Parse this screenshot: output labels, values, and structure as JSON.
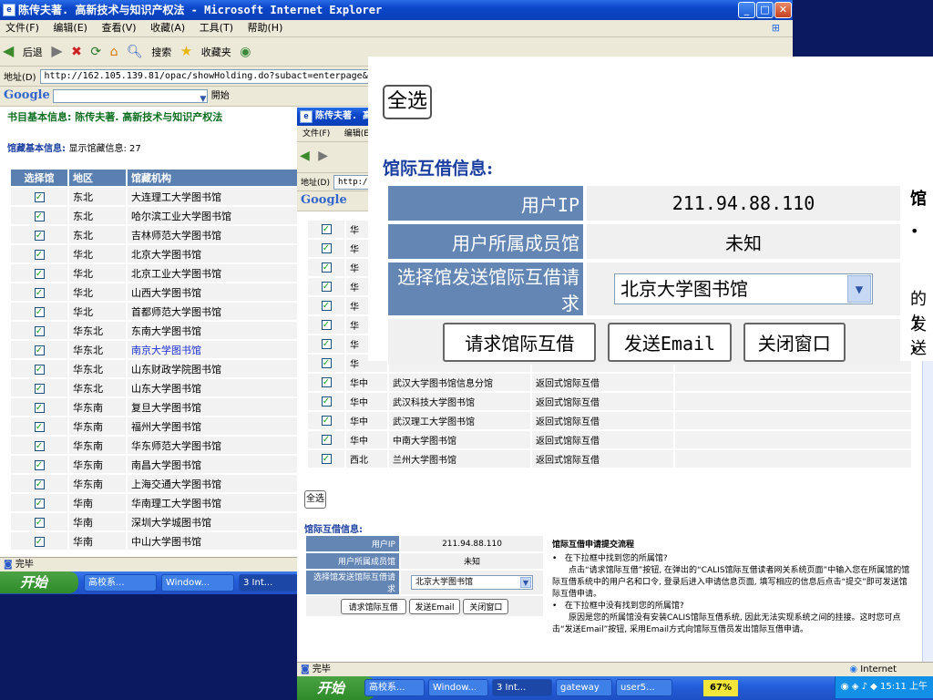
{
  "back_window": {
    "title": "陈传夫著. 高新技术与知识产权法 - Microsoft Internet Explorer",
    "menu": [
      "文件(F)",
      "编辑(E)",
      "查看(V)",
      "收藏(A)",
      "工具(T)",
      "帮助(H)"
    ],
    "toolbar": {
      "back": "后退",
      "search": "搜索",
      "favorites": "收藏夹"
    },
    "address_label": "地址(D)",
    "address": "http://162.105.139.81/opac/showHolding.do?subact=enterpage&fromType",
    "google_label": "Google",
    "google_button": "開始",
    "book_info": "书目基本信息: 陈传夫著. 高新技术与知识产权法",
    "holding_label": "馆藏基本信息:",
    "holding_count": "显示馆藏信息: 27",
    "table_headers": [
      "选择馆",
      "地区",
      "馆藏机构"
    ],
    "rows": [
      {
        "region": "东北",
        "lib": "大连理工大学图书馆"
      },
      {
        "region": "东北",
        "lib": "哈尔滨工业大学图书馆"
      },
      {
        "region": "东北",
        "lib": "吉林师范大学图书馆"
      },
      {
        "region": "华北",
        "lib": "北京大学图书馆"
      },
      {
        "region": "华北",
        "lib": "北京工业大学图书馆"
      },
      {
        "region": "华北",
        "lib": "山西大学图书馆"
      },
      {
        "region": "华北",
        "lib": "首都师范大学图书馆"
      },
      {
        "region": "华东北",
        "lib": "东南大学图书馆"
      },
      {
        "region": "华东北",
        "lib": "南京大学图书馆"
      },
      {
        "region": "华东北",
        "lib": "山东财政学院图书馆"
      },
      {
        "region": "华东北",
        "lib": "山东大学图书馆"
      },
      {
        "region": "华东南",
        "lib": "复旦大学图书馆"
      },
      {
        "region": "华东南",
        "lib": "福州大学图书馆"
      },
      {
        "region": "华东南",
        "lib": "华东师范大学图书馆"
      },
      {
        "region": "华东南",
        "lib": "南昌大学图书馆"
      },
      {
        "region": "华东南",
        "lib": "上海交通大学图书馆"
      },
      {
        "region": "华南",
        "lib": "华南理工大学图书馆"
      },
      {
        "region": "华南",
        "lib": "深圳大学城图书馆"
      },
      {
        "region": "华南",
        "lib": "中山大学图书馆"
      }
    ],
    "highlight_index": 8,
    "status": "完毕",
    "colors": {
      "header_green": "#0e6f20",
      "link_blue": "#1b3fa0",
      "table_head": "#5a7fb1",
      "highlight": "#1a2fd0"
    }
  },
  "back_taskbar": {
    "start": "开始",
    "tasks": [
      "高校系...",
      "Window...",
      "3 Int..."
    ]
  },
  "front_window": {
    "title": "陈传夫著. 高新",
    "menu": [
      "文件(F)",
      "编辑(E)"
    ],
    "address_label": "地址(D)",
    "address_short": "http://",
    "google_label": "Google",
    "rows": [
      {
        "region": "华中",
        "lib": "武汉大学图书馆信息分馆",
        "type": "返回式馆际互借"
      },
      {
        "region": "华中",
        "lib": "武汉科技大学图书馆",
        "type": "返回式馆际互借"
      },
      {
        "region": "华中",
        "lib": "武汉理工大学图书馆",
        "type": "返回式馆际互借"
      },
      {
        "region": "华中",
        "lib": "中南大学图书馆",
        "type": "返回式馆际互借"
      },
      {
        "region": "西北",
        "lib": "兰州大学图书馆",
        "type": "返回式馆际互借"
      }
    ],
    "partial_region": "华",
    "select_all": "全选",
    "ill_title": "馆际互借信息:",
    "user_ip_label": "用户IP",
    "user_ip": "211.94.88.110",
    "member_label": "用户所属成员馆",
    "member_value": "未知",
    "select_label": "选择馆发送馆际互借请求",
    "select_value": "北京大学图书馆",
    "btn_request": "请求馆际互借",
    "btn_email": "发送Email",
    "btn_close": "关闭窗口",
    "procedure_title": "馆际互借申请提交流程",
    "proc_q1": "在下拉框中找到您的所属馆?",
    "proc_a1": "点击“请求馆际互借”按钮, 在弹出的“CALIS馆际互借读者网关系统页面”中输入您在所属馆的馆际互借系统中的用户名和口令, 登录后进入申请信息页面, 填写相应的信息后点击“提交”即可发送馆际互借申请。",
    "proc_q2": "在下拉框中没有找到您的所属馆?",
    "proc_a2": "原因是您的所属馆没有安装CALIS馆际互借系统, 因此无法实现系统之间的挂接。这时您可点击“发送Email”按钮, 采用Email方式向馆际互借员发出馆际互借申请。",
    "status": "完毕",
    "zone": "Internet"
  },
  "zoom_panel": {
    "select_all": "全选",
    "title": "馆际互借信息:",
    "user_ip_label": "用户IP",
    "user_ip": "211.94.88.110",
    "member_label": "用户所属成员馆",
    "member_value": "未知",
    "select_label": "选择馆发送馆际互借请求",
    "select_value": "北京大学图书馆",
    "btn_request": "请求馆际互借",
    "btn_email": "发送Email",
    "btn_close": "关闭窗口",
    "right_fragments": [
      "馆",
      "的饣",
      "发送"
    ]
  },
  "taskbar": {
    "start": "开始",
    "tasks": [
      "高校系...",
      "Window...",
      "3 Int...",
      "gateway",
      "user5..."
    ],
    "percent": "67%",
    "clock": "15:11 上午"
  }
}
